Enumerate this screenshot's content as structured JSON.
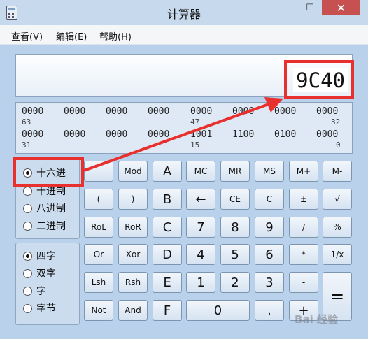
{
  "window": {
    "title": "计算器"
  },
  "menu": {
    "view": "查看(V)",
    "edit": "编辑(E)",
    "help": "帮助(H)"
  },
  "display": {
    "value": "9C40"
  },
  "bits": {
    "row1": [
      "0000",
      "0000",
      "0000",
      "0000",
      "0000",
      "0000",
      "0000",
      "0000"
    ],
    "row1_idx": [
      "63",
      "47",
      "32"
    ],
    "row2": [
      "0000",
      "0000",
      "0000",
      "0000",
      "1001",
      "1100",
      "0100",
      "0000"
    ],
    "row2_idx": [
      "31",
      "15",
      "0"
    ]
  },
  "radix": {
    "hex": "十六进",
    "dec": "十进制",
    "oct": "八进制",
    "bin": "二进制",
    "selected": "hex"
  },
  "word": {
    "qword": "四字",
    "dword": "双字",
    "word": "字",
    "byte": "字节",
    "selected": "qword"
  },
  "keys": {
    "mod": "Mod",
    "a": "A",
    "mc": "MC",
    "mr": "MR",
    "ms": "MS",
    "mplus": "M+",
    "mminus": "M-",
    "lparen": "(",
    "rparen": ")",
    "b": "B",
    "back": "←",
    "ce": "CE",
    "c": "C",
    "plusminus": "±",
    "sqrt": "√",
    "rol": "RoL",
    "ror": "RoR",
    "c_hex": "C",
    "seven": "7",
    "eight": "8",
    "nine": "9",
    "divide": "/",
    "percent": "%",
    "or": "Or",
    "xor": "Xor",
    "d": "D",
    "four": "4",
    "five": "5",
    "six": "6",
    "multiply": "*",
    "reciprocal": "1/x",
    "lsh": "Lsh",
    "rsh": "Rsh",
    "e": "E",
    "one": "1",
    "two": "2",
    "three": "3",
    "minus": "-",
    "equals": "=",
    "not": "Not",
    "and": "And",
    "f": "F",
    "zero": "0",
    "dot": ".",
    "plus": "+"
  },
  "colors": {
    "annotation": "#e8302f",
    "window_bg": "#b9d1ea"
  },
  "watermark": "Bai 经验"
}
